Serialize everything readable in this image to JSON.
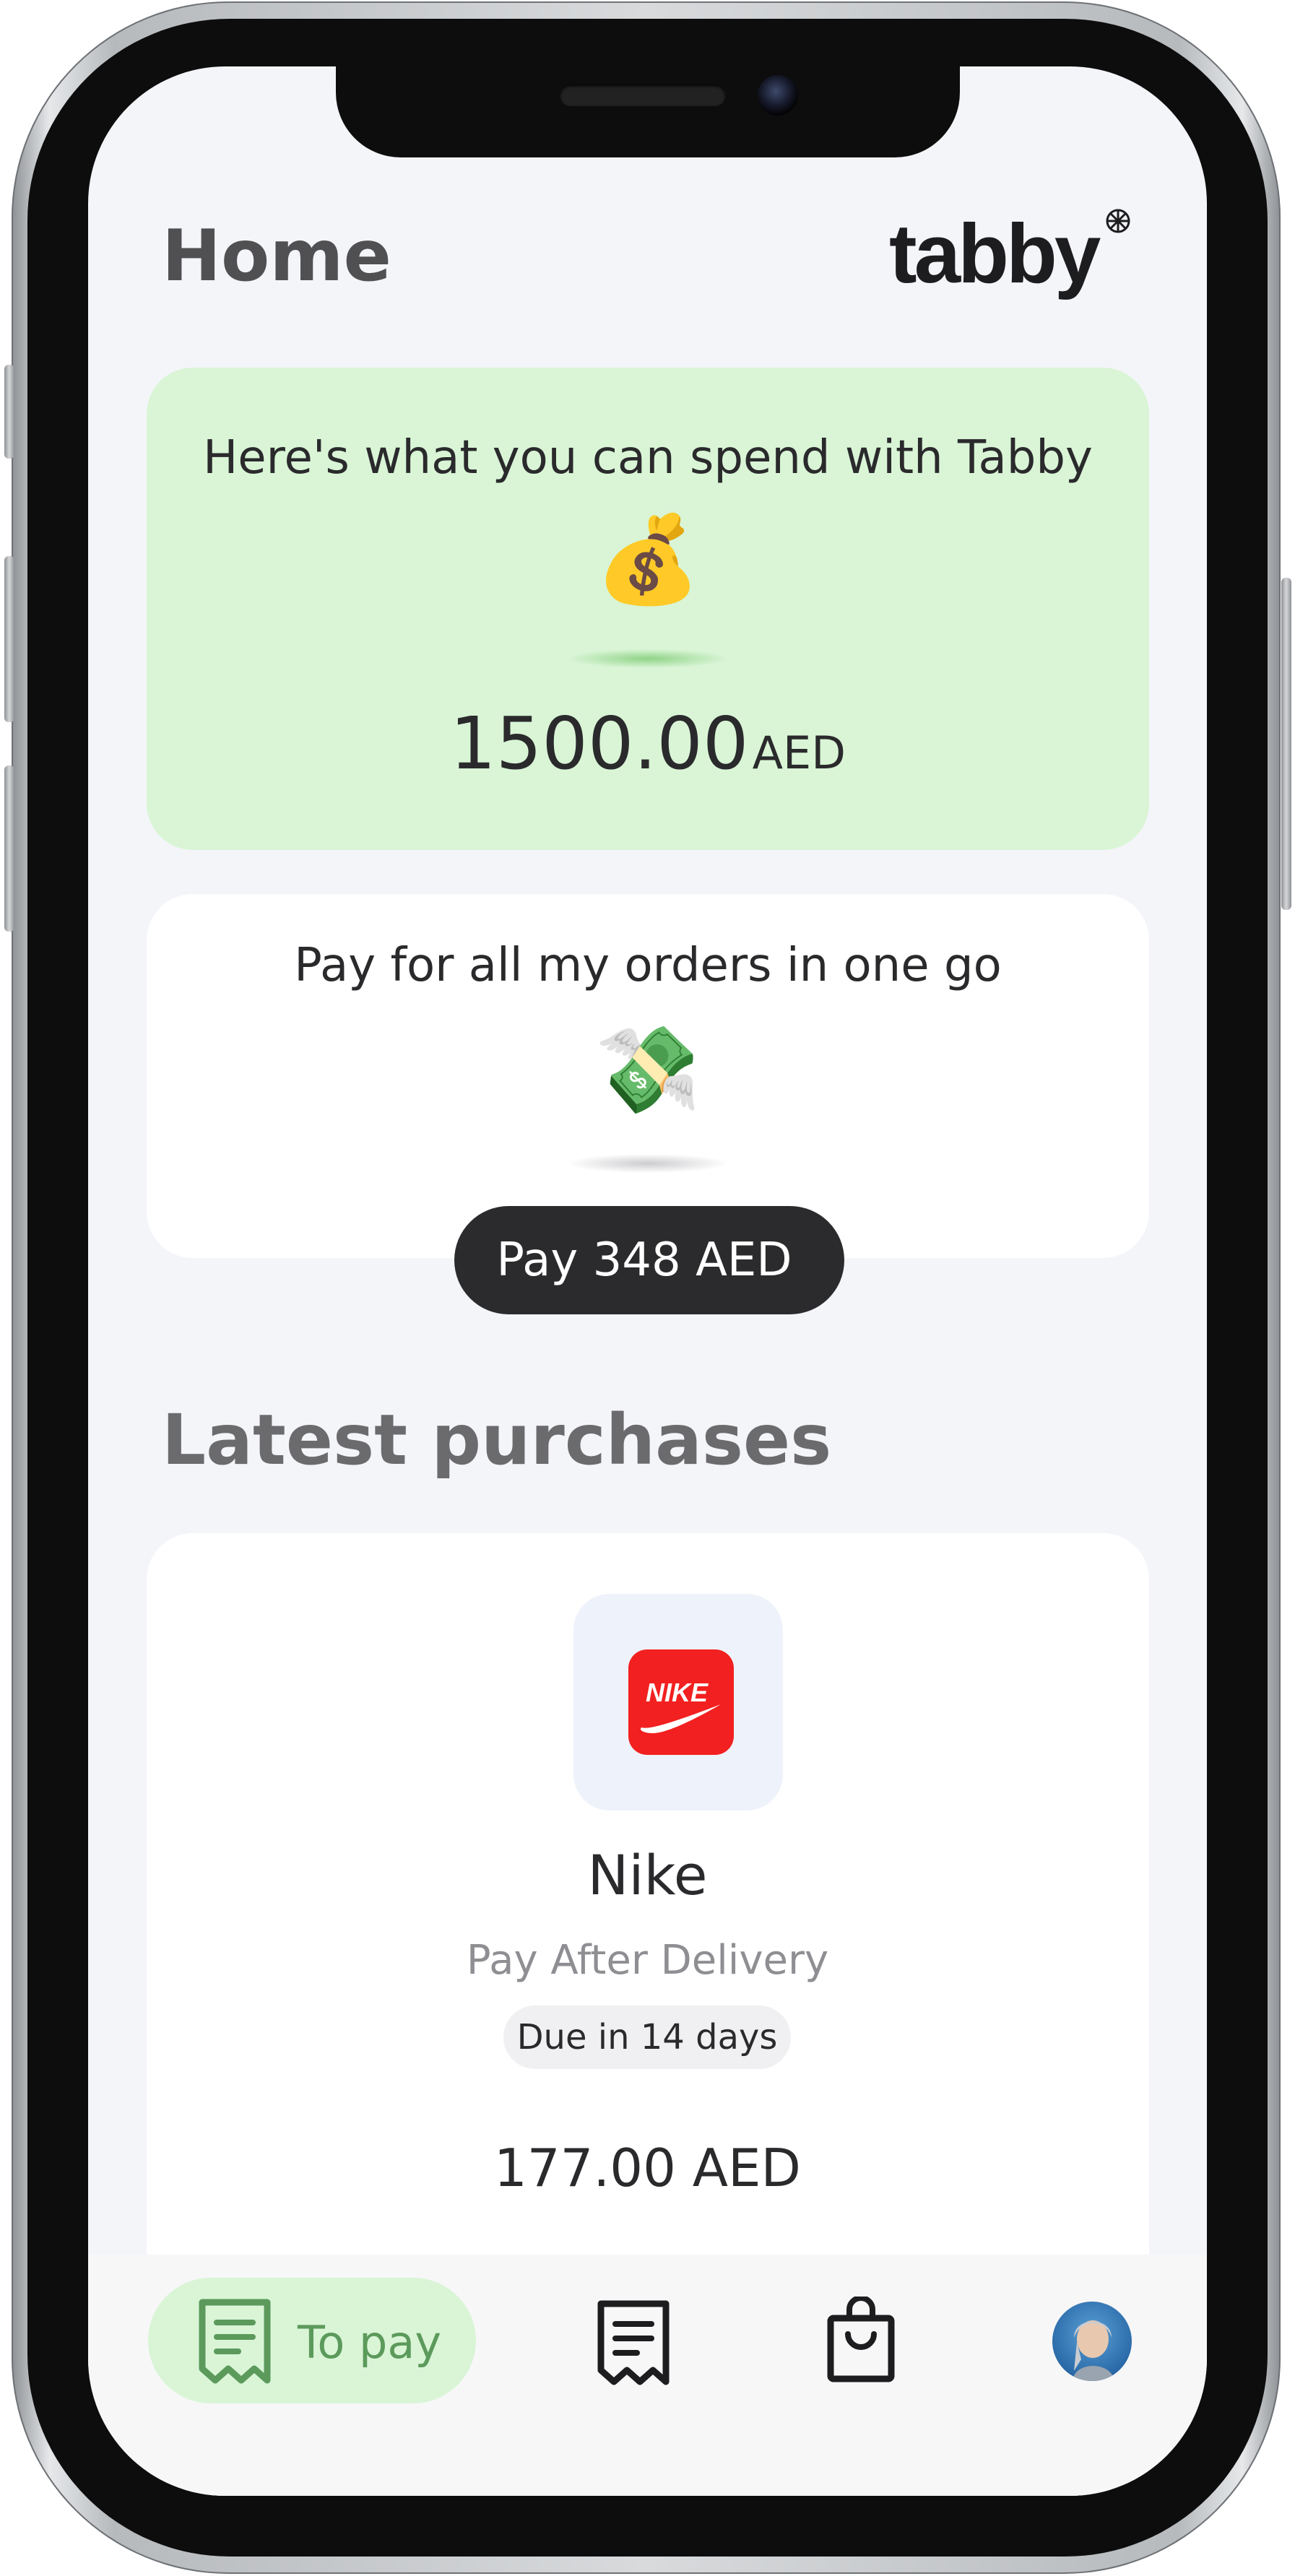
{
  "header": {
    "title": "Home",
    "logo_text": "tabby"
  },
  "spend_card": {
    "caption": "Here's what you can spend with Tabby",
    "emoji": "💰",
    "amount": "1500.00",
    "currency": "AED",
    "accent": "#d9f5d6"
  },
  "pay_all_card": {
    "caption": "Pay for all my orders in one go",
    "emoji": "💸",
    "button_label": "Pay 348 AED"
  },
  "latest": {
    "section_title": "Latest purchases",
    "items": [
      {
        "merchant": "Nike",
        "brand_logo_text": "NIKE",
        "plan": "Pay After Delivery",
        "due": "Due in 14 days",
        "amount": "177.00 AED"
      }
    ]
  },
  "tabbar": {
    "active_label": "To pay",
    "active_color": "#5c9a5c",
    "icons": [
      "receipt-icon",
      "receipt-icon",
      "shopping-bag-icon",
      "profile-avatar"
    ]
  }
}
